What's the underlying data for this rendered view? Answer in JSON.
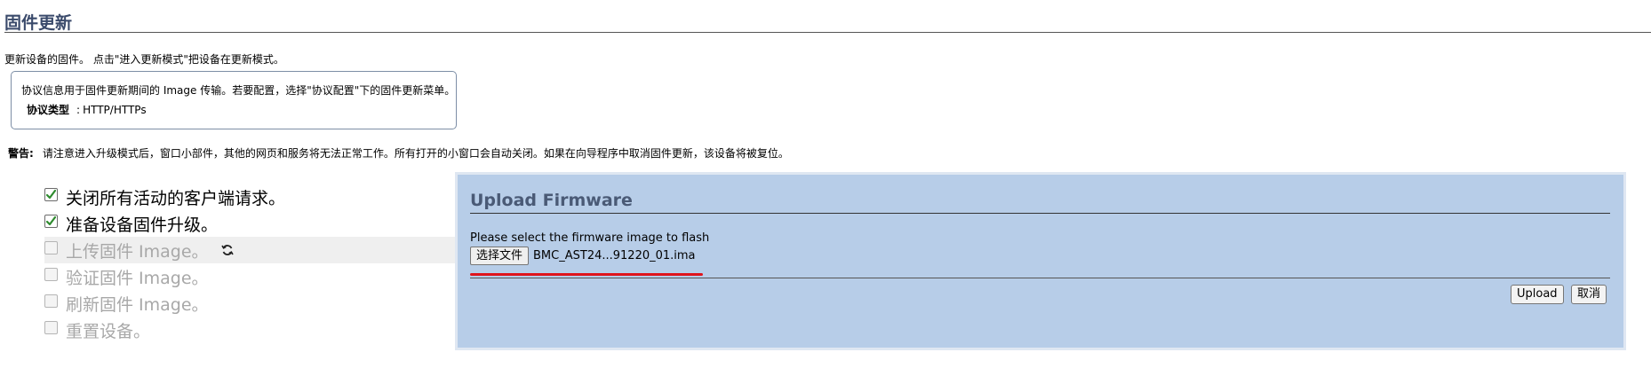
{
  "page": {
    "title": "固件更新",
    "description": "更新设备的固件。 点击\"进入更新模式\"把设备在更新模式。"
  },
  "info_box": {
    "text": "协议信息用于固件更新期间的 Image 传输。若要配置，选择\"协议配置\"下的固件更新菜单。",
    "protocol_label": "协议类型",
    "protocol_sep": ":",
    "protocol_value": "HTTP/HTTPs"
  },
  "warning": {
    "label": "警告:",
    "text": "请注意进入升级模式后，窗口小部件，其他的网页和服务将无法正常工作。所有打开的小窗口会自动关闭。如果在向导程序中取消固件更新，该设备将被复位。"
  },
  "steps": [
    {
      "label": "关闭所有活动的客户端请求。",
      "checked": true,
      "state": "done"
    },
    {
      "label": "准备设备固件升级。",
      "checked": true,
      "state": "done"
    },
    {
      "label": "上传固件 Image。",
      "checked": false,
      "state": "active"
    },
    {
      "label": "验证固件 Image。",
      "checked": false,
      "state": "pending"
    },
    {
      "label": "刷新固件 Image。",
      "checked": false,
      "state": "pending"
    },
    {
      "label": "重置设备。",
      "checked": false,
      "state": "pending"
    }
  ],
  "upload_panel": {
    "title": "Upload Firmware",
    "prompt": "Please select the firmware image to flash",
    "choose_file_label": "选择文件",
    "file_name": "BMC_AST24...91220_01.ima",
    "upload_label": "Upload",
    "cancel_label": "取消"
  },
  "colors": {
    "panel_bg": "#b7cde8",
    "title_color": "#3a4a6b",
    "highlight_underline": "#e0141c",
    "checkbox_check": "#2e8b2e"
  },
  "icons": {
    "step_in_progress": "spinner-icon",
    "checkbox_checked": "checkmark-icon"
  }
}
